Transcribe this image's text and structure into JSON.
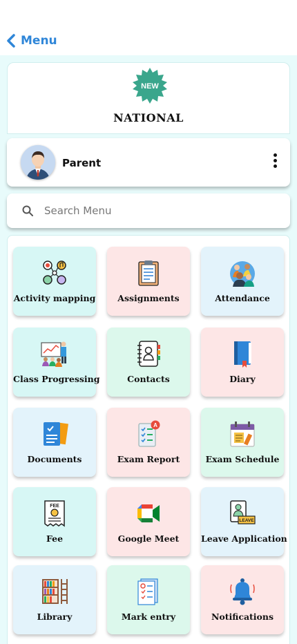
{
  "header": {
    "back_label": "Menu"
  },
  "school": {
    "badge_text": "NEW",
    "name": "NATIONAL",
    "badge_color": "#3aa68c"
  },
  "profile": {
    "role": "Parent"
  },
  "search": {
    "placeholder": "Search Menu",
    "value": ""
  },
  "menu": [
    {
      "label": "Activity mapping",
      "icon": "activity-icon"
    },
    {
      "label": "Assignments",
      "icon": "clipboard-icon"
    },
    {
      "label": "Attendance",
      "icon": "people-icon"
    },
    {
      "label": "Class Progressing",
      "icon": "presentation-icon"
    },
    {
      "label": "Contacts",
      "icon": "address-book-icon"
    },
    {
      "label": "Diary",
      "icon": "diary-icon"
    },
    {
      "label": "Documents",
      "icon": "documents-icon"
    },
    {
      "label": "Exam Report",
      "icon": "exam-report-icon"
    },
    {
      "label": "Exam Schedule",
      "icon": "calendar-icon"
    },
    {
      "label": "Fee",
      "icon": "fee-receipt-icon"
    },
    {
      "label": "Google Meet",
      "icon": "google-meet-icon"
    },
    {
      "label": "Leave Application",
      "icon": "leave-icon"
    },
    {
      "label": "Library",
      "icon": "bookshelf-icon"
    },
    {
      "label": "Mark entry",
      "icon": "mark-entry-icon"
    },
    {
      "label": "Notifications",
      "icon": "bell-icon"
    }
  ],
  "colors": {
    "accent": "#2f86d8",
    "background": "#e8fbfb"
  }
}
